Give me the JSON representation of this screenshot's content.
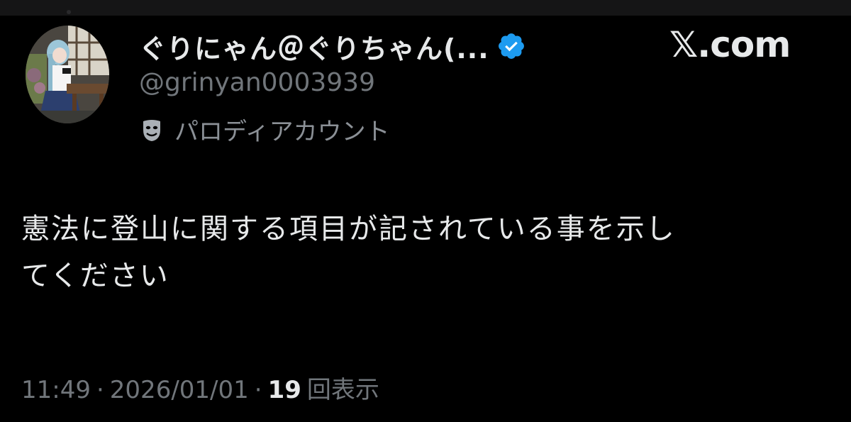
{
  "author": {
    "display_name": "ぐりにゃん＠ぐりちゃん(...",
    "handle": "@grinyan0003939",
    "account_label": "パロディアカウント",
    "verified": true,
    "avatar": "profile-photo"
  },
  "brand": {
    "logo_text": "𝕏.com"
  },
  "tweet": {
    "text_lines": [
      "憲法に登山に関する項目が記されている事を示し",
      "てください"
    ],
    "time": "11:49",
    "separator": "·",
    "date": "2026/01/01",
    "views_count": "19",
    "views_label": "回表示"
  },
  "colors": {
    "background": "#000000",
    "text_primary": "#e7e9ea",
    "text_secondary": "#71767b",
    "verified_badge": "#1d9bf0"
  },
  "icons": {
    "verified": "verified-badge-icon",
    "parody": "parody-mask-icon"
  }
}
